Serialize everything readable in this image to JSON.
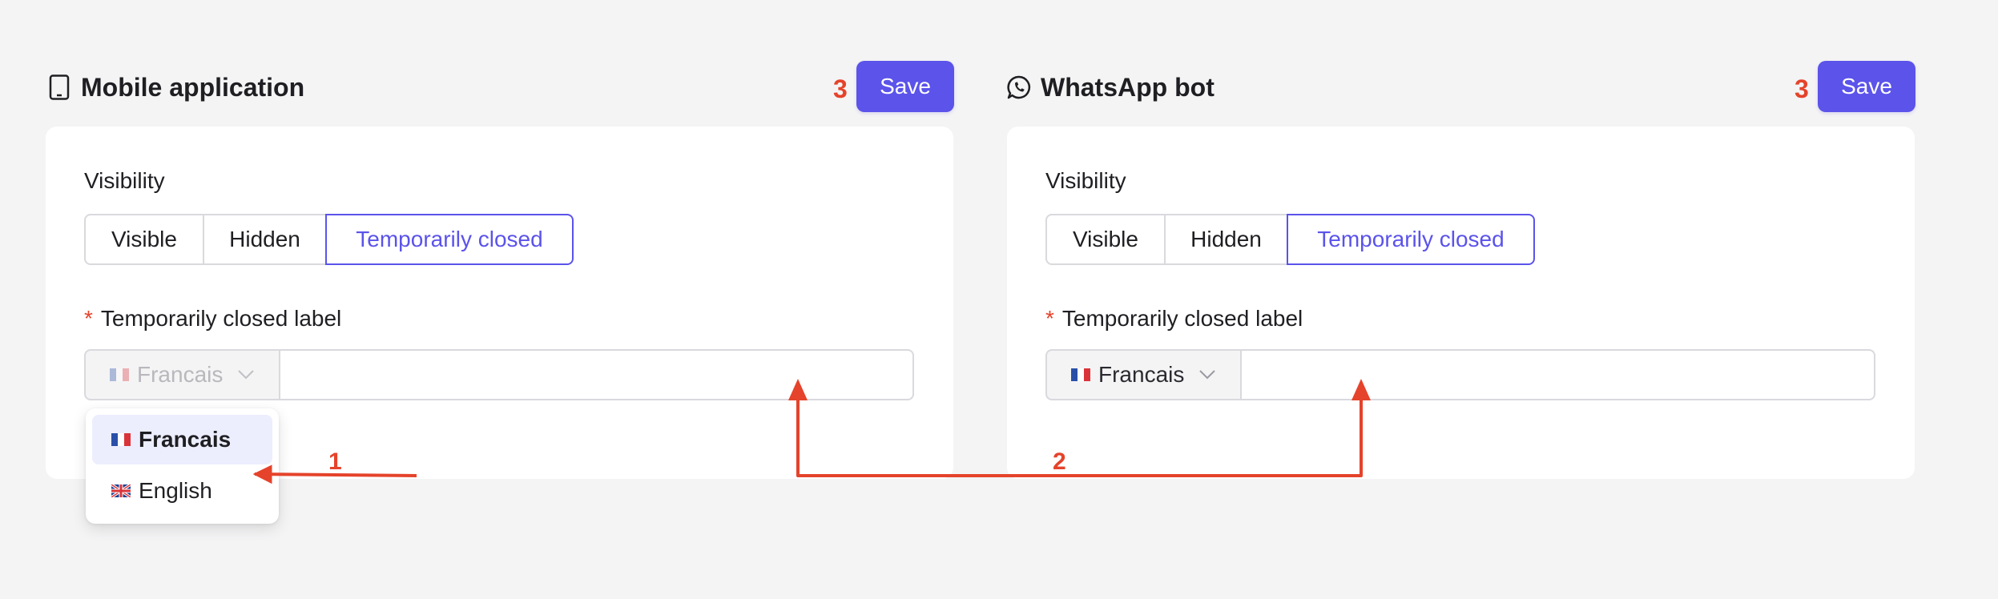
{
  "panels": [
    {
      "title": "Mobile application",
      "icon": "mobile-phone-icon",
      "save_label": "Save",
      "step": "3",
      "visibility_label": "Visibility",
      "visibility_options": [
        "Visible",
        "Hidden",
        "Temporarily closed"
      ],
      "selected_visibility": "Temporarily closed",
      "closed_label": "Temporarily closed label",
      "required_mark": "*",
      "language": "Francais",
      "text_value": ""
    },
    {
      "title": "WhatsApp bot",
      "icon": "whatsapp-icon",
      "save_label": "Save",
      "step": "3",
      "visibility_label": "Visibility",
      "visibility_options": [
        "Visible",
        "Hidden",
        "Temporarily closed"
      ],
      "selected_visibility": "Temporarily closed",
      "closed_label": "Temporarily closed label",
      "required_mark": "*",
      "language": "Francais",
      "text_value": ""
    }
  ],
  "language_dropdown": {
    "options": [
      {
        "label": "Francais",
        "flag": "france-flag-icon",
        "selected": true
      },
      {
        "label": "English",
        "flag": "uk-flag-icon",
        "selected": false
      }
    ]
  },
  "annotations": {
    "step1": "1",
    "step2": "2",
    "color": "#e5432b"
  },
  "colors": {
    "accent": "#5b53ea",
    "background": "#f4f4f5",
    "annotation": "#e5432b"
  }
}
